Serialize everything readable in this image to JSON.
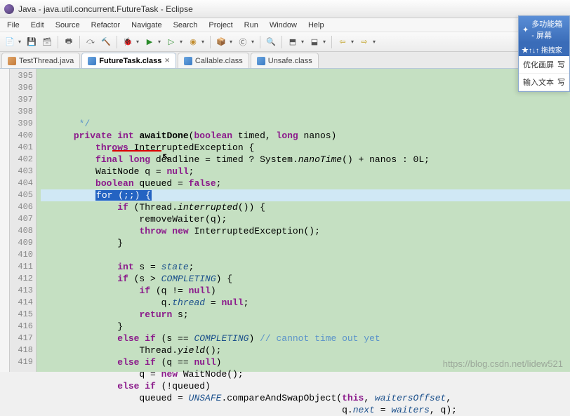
{
  "window": {
    "title": "Java - java.util.concurrent.FutureTask - Eclipse"
  },
  "menu": [
    "File",
    "Edit",
    "Source",
    "Refactor",
    "Navigate",
    "Search",
    "Project",
    "Run",
    "Window",
    "Help"
  ],
  "toolbar_icons": [
    "new",
    "save",
    "saveall",
    "print",
    "|",
    "skip",
    "link",
    "|",
    "debug",
    "run",
    "runext",
    "extern",
    "|",
    "pkg",
    "type",
    "|",
    "search",
    "ann",
    "task",
    "|",
    "back",
    "fwd"
  ],
  "tabs": [
    {
      "label": "TestThread.java",
      "active": false,
      "kind": "j"
    },
    {
      "label": "FutureTask.class",
      "active": true,
      "kind": "c",
      "close": "✕"
    },
    {
      "label": "Callable.class",
      "active": false,
      "kind": "c"
    },
    {
      "label": "Unsafe.class",
      "active": false,
      "kind": "c"
    }
  ],
  "gutter_start": 395,
  "gutter_end": 419,
  "code_lines": [
    {
      "n": 395,
      "raw": "       */",
      "cls": "cm"
    },
    {
      "n": 396,
      "segs": [
        "      ",
        [
          "kw",
          "private"
        ],
        " ",
        [
          "rt",
          "int"
        ],
        " ",
        [
          "mth",
          "awaitDone"
        ],
        "(",
        [
          "kw",
          "boolean"
        ],
        " timed, ",
        [
          "kw",
          "long"
        ],
        " nanos)"
      ]
    },
    {
      "n": 397,
      "segs": [
        "          ",
        [
          "kw",
          "throws"
        ],
        " InterruptedException {"
      ]
    },
    {
      "n": 398,
      "segs": [
        "          ",
        [
          "kw",
          "final"
        ],
        " ",
        [
          "rt",
          "long"
        ],
        " deadline = timed ? System.",
        [
          "it",
          "nanoTime"
        ],
        "() + nanos : 0L;"
      ]
    },
    {
      "n": 399,
      "raw": "          WaitNode q = null;",
      "segs": [
        "          WaitNode q = ",
        [
          "kw",
          "null"
        ],
        ";"
      ]
    },
    {
      "n": 400,
      "segs": [
        "          ",
        [
          "kw",
          "boolean"
        ],
        " queued = ",
        [
          "kw",
          "false"
        ],
        ";"
      ]
    },
    {
      "n": 401,
      "hl": true,
      "sel": "for (;;) {",
      "pre": "          "
    },
    {
      "n": 402,
      "segs": [
        "              ",
        [
          "kw",
          "if"
        ],
        " (Thread.",
        [
          "it",
          "interrupted"
        ],
        "()) {"
      ]
    },
    {
      "n": 403,
      "raw": "                  removeWaiter(q);"
    },
    {
      "n": 404,
      "segs": [
        "                  ",
        [
          "kw",
          "throw"
        ],
        " ",
        [
          "kw",
          "new"
        ],
        " InterruptedException();"
      ]
    },
    {
      "n": 405,
      "raw": "              }"
    },
    {
      "n": 406,
      "raw": ""
    },
    {
      "n": 407,
      "segs": [
        "              ",
        [
          "kw",
          "int"
        ],
        " s = ",
        [
          "st",
          "state"
        ],
        ";"
      ]
    },
    {
      "n": 408,
      "segs": [
        "              ",
        [
          "kw",
          "if"
        ],
        " (s > ",
        [
          "st",
          "COMPLETING"
        ],
        ") {"
      ]
    },
    {
      "n": 409,
      "segs": [
        "                  ",
        [
          "kw",
          "if"
        ],
        " (q != ",
        [
          "kw",
          "null"
        ],
        ")"
      ]
    },
    {
      "n": 410,
      "segs": [
        "                      q.",
        [
          "st",
          "thread"
        ],
        " = ",
        [
          "kw",
          "null"
        ],
        ";"
      ]
    },
    {
      "n": 411,
      "segs": [
        "                  ",
        [
          "kw",
          "return"
        ],
        " s;"
      ]
    },
    {
      "n": 412,
      "raw": "              }"
    },
    {
      "n": 413,
      "segs": [
        "              ",
        [
          "kw",
          "else if"
        ],
        " (s == ",
        [
          "st",
          "COMPLETING"
        ],
        ") ",
        [
          "cm",
          "// cannot time out yet"
        ]
      ]
    },
    {
      "n": 414,
      "segs": [
        "                  Thread.",
        [
          "it",
          "yield"
        ],
        "();"
      ]
    },
    {
      "n": 415,
      "segs": [
        "              ",
        [
          "kw",
          "else if"
        ],
        " (q == ",
        [
          "kw",
          "null"
        ],
        ")"
      ]
    },
    {
      "n": 416,
      "segs": [
        "                  q = ",
        [
          "kw",
          "new"
        ],
        " WaitNode();"
      ]
    },
    {
      "n": 417,
      "segs": [
        "              ",
        [
          "kw",
          "else if"
        ],
        " (!queued)"
      ]
    },
    {
      "n": 418,
      "segs": [
        "                  queued = ",
        [
          "st",
          "UNSAFE"
        ],
        ".compareAndSwapObject(",
        [
          "kw",
          "this"
        ],
        ", ",
        [
          "st",
          "waitersOffset"
        ],
        ","
      ]
    },
    {
      "n": 419,
      "segs": [
        "                                                       q.",
        [
          "st",
          "next"
        ],
        " = ",
        [
          "st",
          "waiters"
        ],
        ", q);"
      ]
    }
  ],
  "side_panel": {
    "title": "多功能箱 - 屏幕",
    "subtitle": "★↑↓↑ 拖拽家",
    "rows": [
      {
        "label": "优化画屏",
        "r": "写"
      },
      {
        "label": "输入文本",
        "r": "写"
      }
    ]
  },
  "watermark": "https://blog.csdn.net/lidew521"
}
